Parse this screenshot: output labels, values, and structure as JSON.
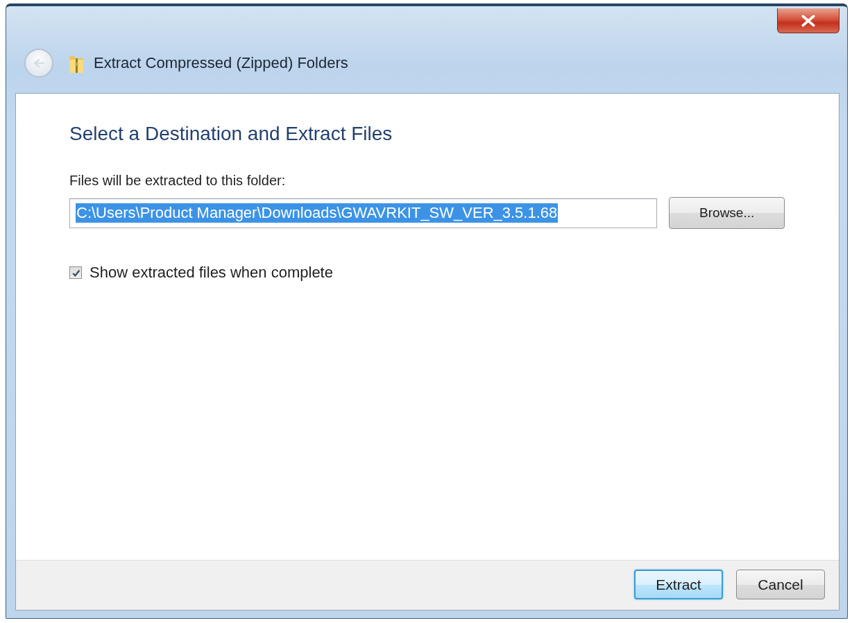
{
  "window": {
    "title": "Extract Compressed (Zipped) Folders"
  },
  "heading": "Select a Destination and Extract Files",
  "destination": {
    "label": "Files will be extracted to this folder:",
    "value": "C:\\Users\\Product Manager\\Downloads\\GWAVRKIT_SW_VER_3.5.1.68",
    "text_selected": true
  },
  "browse_button": "Browse...",
  "options": [
    {
      "label": "Show extracted files when complete",
      "checked": true
    }
  ],
  "buttons": [
    {
      "label": "Extract",
      "default": true
    },
    {
      "label": "Cancel",
      "default": false
    }
  ]
}
